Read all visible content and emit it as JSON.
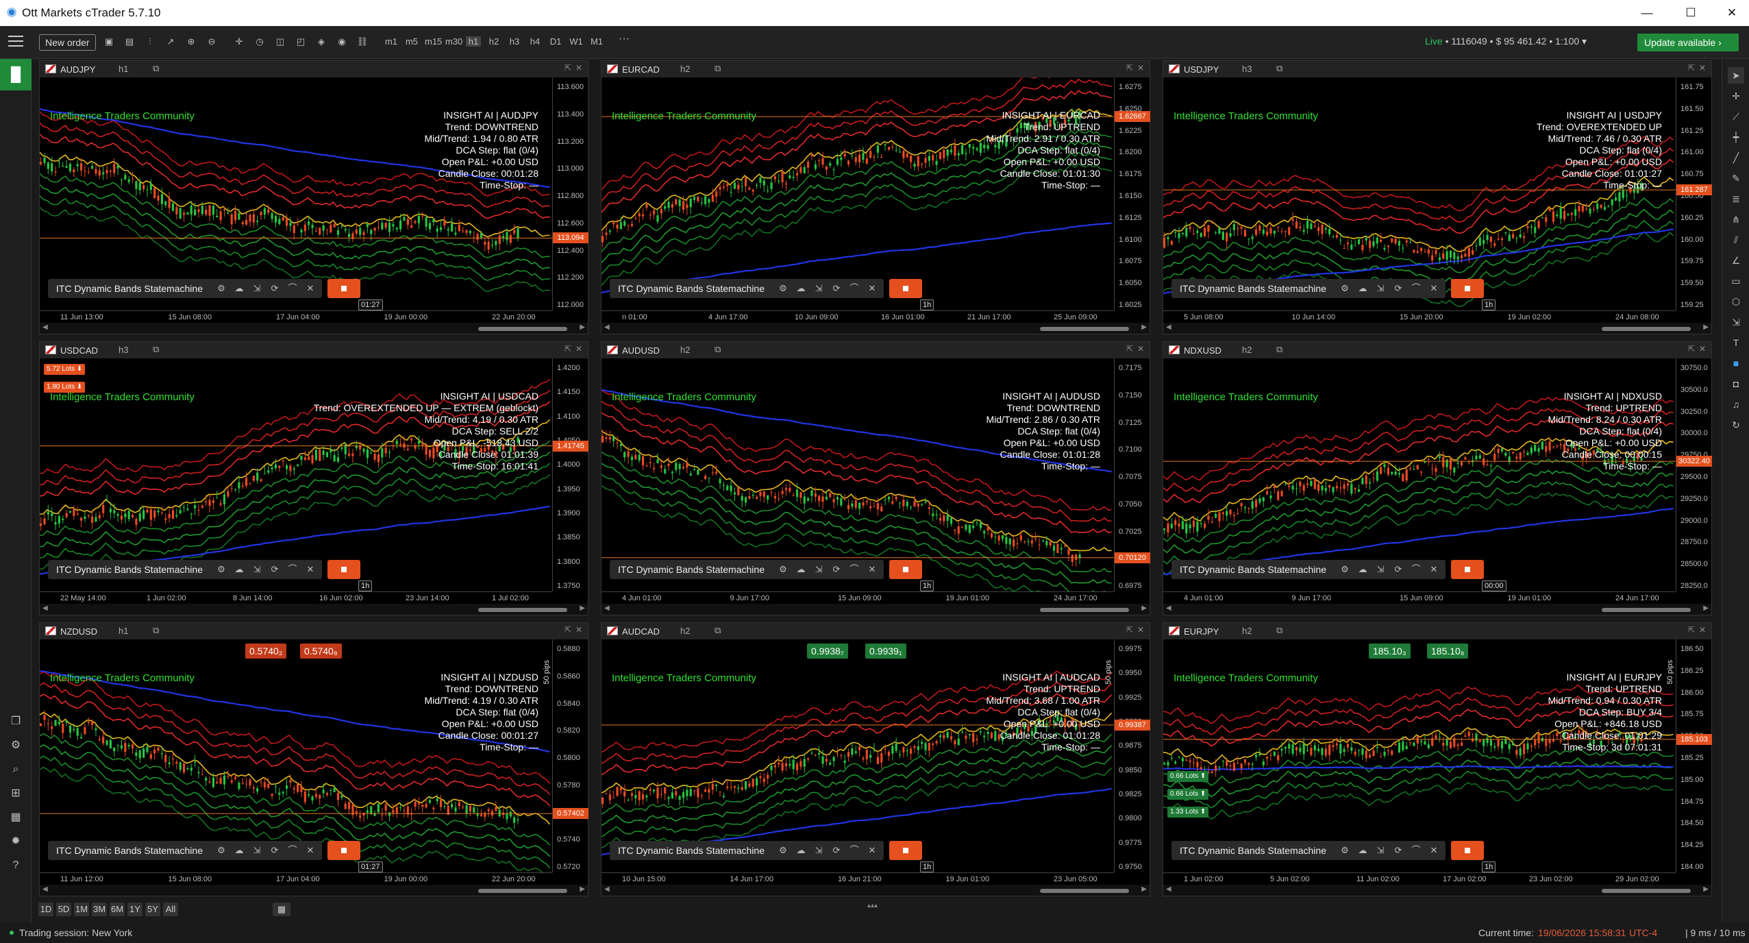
{
  "window": {
    "title": "Ott Markets cTrader 5.7.10",
    "minimize": "—",
    "maximize": "☐",
    "close": "✕"
  },
  "toolbar": {
    "new_order": "New order",
    "timeframes": [
      "m1",
      "m5",
      "m15",
      "m30",
      "h1",
      "h2",
      "h3",
      "h4",
      "D1",
      "W1",
      "M1"
    ],
    "more": "···",
    "account_live": "Live",
    "account_info": "• 1116049 • $ 95 461.42 • 1:100 ▾",
    "update": "Update available ›"
  },
  "indicator_label": "ITC Dynamic Bands Statemachine",
  "watermark": "Intelligence Traders Community",
  "colors": {
    "green": "#2ec25b",
    "orange": "#e4501e",
    "bg": "#000000",
    "accent_green": "#1f8b3a"
  },
  "panels": [
    {
      "symbol": "AUDJPY",
      "tf": "h1",
      "yticks": [
        "113.600",
        "113.400",
        "113.200",
        "113.000",
        "112.800",
        "112.600",
        "112.400",
        "112.200",
        "112.000"
      ],
      "price_tag": "113.094",
      "xticks": [
        "11 Jun 13:00",
        "15 Jun 08:00",
        "17 Jun 04:00",
        "19 Jun 00:00",
        "22 Jun 20:00"
      ],
      "tf_badge": "01:27",
      "trend": "down",
      "overlay": [
        "INSIGHT AI | AUDJPY",
        "Trend: DOWNTREND",
        "Mid/Trend: 1.94 / 0.80 ATR",
        "DCA Step: flat (0/4)",
        "Open P&L: +0.00 USD",
        "Candle Close: 00:01:28",
        "Time-Stop: —"
      ]
    },
    {
      "symbol": "EURCAD",
      "tf": "h2",
      "yticks": [
        "1.6275",
        "1.6250",
        "1.6225",
        "1.6200",
        "1.6175",
        "1.6150",
        "1.6125",
        "1.6100",
        "1.6075",
        "1.6050",
        "1.6025"
      ],
      "price_tag": "1.62667",
      "xticks": [
        "n 01:00",
        "4 Jun 17:00",
        "10 Jun 09:00",
        "16 Jun 01:00",
        "21 Jun 17:00",
        "25 Jun 09:00"
      ],
      "tf_badge": "1h",
      "trend": "up",
      "overlay": [
        "INSIGHT AI | EURCAD",
        "Trend: UPTREND",
        "Mid/Trend: 2.91 / 0.30 ATR",
        "DCA Step: flat (0/4)",
        "Open P&L: +0.00 USD",
        "Candle Close: 01:01:30",
        "Time-Stop: —"
      ]
    },
    {
      "symbol": "USDJPY",
      "tf": "h3",
      "yticks": [
        "161.75",
        "161.50",
        "161.25",
        "161.00",
        "160.75",
        "160.50",
        "160.25",
        "160.00",
        "159.75",
        "159.50",
        "159.25"
      ],
      "price_tag": "161.287",
      "xticks": [
        "5 Jun 08:00",
        "10 Jun 14:00",
        "15 Jun 20:00",
        "19 Jun 02:00",
        "24 Jun 08:00"
      ],
      "tf_badge": "1h",
      "trend": "up",
      "overlay": [
        "INSIGHT AI | USDJPY",
        "Trend: OVEREXTENDED UP",
        "Mid/Trend: 7.46 / 0.30 ATR",
        "DCA Step: flat (0/4)",
        "Open P&L: +0.00 USD",
        "Candle Close: 01:01:27",
        "Time-Stop: —"
      ]
    },
    {
      "symbol": "USDCAD",
      "tf": "h3",
      "yticks": [
        "1.4200",
        "1.4150",
        "1.4100",
        "1.4050",
        "1.4000",
        "1.3950",
        "1.3900",
        "1.3850",
        "1.3800",
        "1.3750"
      ],
      "price_tag": "1.41745",
      "xticks": [
        "22 May 14:00",
        "1 Jun 02:00",
        "8 Jun 14:00",
        "16 Jun 02:00",
        "23 Jun 14:00",
        "1 Jul 02:00"
      ],
      "tf_badge": "1h",
      "trend": "up",
      "lots": [
        "5.72 Lots ⬇",
        "1.90 Lots ⬇"
      ],
      "overlay": [
        "INSIGHT AI | USDCAD",
        "Trend: OVEREXTENDED UP — EXTREM (geblockt)",
        "Mid/Trend: 4.19 / 0.30 ATR",
        "DCA Step: SELL 2/2",
        "Open P&L: -518.43 USD",
        "Candle Close: 01:01:39",
        "Time-Stop: 16:01:41"
      ]
    },
    {
      "symbol": "AUDUSD",
      "tf": "h2",
      "yticks": [
        "0.7175",
        "0.7150",
        "0.7125",
        "0.7100",
        "0.7075",
        "0.7050",
        "0.7025",
        "0.7000",
        "0.6975"
      ],
      "price_tag": "0.70120",
      "xticks": [
        "4 Jun 01:00",
        "9 Jun 17:00",
        "15 Jun 09:00",
        "19 Jun 01:00",
        "24 Jun 17:00"
      ],
      "tf_badge": "1h",
      "trend": "down",
      "overlay": [
        "INSIGHT AI | AUDUSD",
        "Trend: DOWNTREND",
        "Mid/Trend: 2.86 / 0.30 ATR",
        "DCA Step: flat (0/4)",
        "Open P&L: +0.00 USD",
        "Candle Close: 01:01:28",
        "Time-Stop: —"
      ]
    },
    {
      "symbol": "NDXUSD",
      "tf": "h2",
      "yticks": [
        "30750.0",
        "30500.0",
        "30250.0",
        "30000.0",
        "29750.0",
        "29500.0",
        "29250.0",
        "29000.0",
        "28750.0",
        "28500.0",
        "28250.0"
      ],
      "price_tag": "30322.40",
      "xticks": [
        "4 Jun 01:00",
        "9 Jun 17:00",
        "15 Jun 09:00",
        "19 Jun 01:00",
        "24 Jun 17:00"
      ],
      "tf_badge": "00:00",
      "trend": "up",
      "overlay": [
        "INSIGHT AI | NDXUSD",
        "Trend: UPTREND",
        "Mid/Trend: 8.24 / 0.30 ATR",
        "DCA Step: flat (0/4)",
        "Open P&L: +0.00 USD",
        "Candle Close: 00:00:15",
        "Time-Stop: —"
      ]
    },
    {
      "symbol": "NZDUSD",
      "tf": "h1",
      "yticks": [
        "0.5880",
        "0.5860",
        "0.5840",
        "0.5820",
        "0.5800",
        "0.5780",
        "0.5760",
        "0.5740",
        "0.5720"
      ],
      "price_tag": "0.57402",
      "xticks": [
        "11 Jun 12:00",
        "15 Jun 08:00",
        "17 Jun 04:00",
        "19 Jun 00:00",
        "22 Jun 20:00"
      ],
      "tf_badge": "01:27",
      "trend": "down",
      "quotes": [
        "0.5740₂",
        "0.5740₈"
      ],
      "pips": "50 pips",
      "overlay": [
        "INSIGHT AI | NZDUSD",
        "Trend: DOWNTREND",
        "Mid/Trend: 4.19 / 0.30 ATR",
        "DCA Step: flat (0/4)",
        "Open P&L: +0.00 USD",
        "Candle Close: 00:01:27",
        "Time-Stop: —"
      ]
    },
    {
      "symbol": "AUDCAD",
      "tf": "h2",
      "yticks": [
        "0.9975",
        "0.9950",
        "0.9925",
        "0.9900",
        "0.9875",
        "0.9850",
        "0.9825",
        "0.9800",
        "0.9775",
        "0.9750"
      ],
      "price_tag": "0.99387",
      "xticks": [
        "10 Jun 15:00",
        "14 Jun 17:00",
        "16 Jun 21:00",
        "19 Jun 01:00",
        "23 Jun 05:00"
      ],
      "tf_badge": "1h",
      "trend": "up",
      "quotes": [
        "0.9938₇",
        "0.9939₁"
      ],
      "pips": "50 pips",
      "overlay": [
        "INSIGHT AI | AUDCAD",
        "Trend: UPTREND",
        "Mid/Trend: 3.68 / 1.00 ATR",
        "DCA Step: flat (0/4)",
        "Open P&L: +0.00 USD",
        "Candle Close: 01:01:28",
        "Time-Stop: —"
      ]
    },
    {
      "symbol": "EURJPY",
      "tf": "h2",
      "yticks": [
        "186.50",
        "186.25",
        "186.00",
        "185.75",
        "185.50",
        "185.25",
        "185.00",
        "184.75",
        "184.50",
        "184.25",
        "184.00"
      ],
      "price_tag": "185.103",
      "xticks": [
        "1 Jun 02:00",
        "5 Jun 02:00",
        "11 Jun 02:00",
        "17 Jun 02:00",
        "23 Jun 02:00",
        "29 Jun 02:00"
      ],
      "tf_badge": "1h",
      "trend": "flat",
      "quotes": [
        "185.10₃",
        "185.10₆"
      ],
      "pips": "50 pips",
      "lots": [
        "0.66 Lots ⬆",
        "0.66 Lots ⬆",
        "1.33 Lots ⬆"
      ],
      "overlay": [
        "INSIGHT AI | EURJPY",
        "Trend: UPTREND",
        "Mid/Trend: 0.94 / 0.30 ATR",
        "DCA Step: BUY 3/4",
        "Open P&L: +846.18 USD",
        "Candle Close: 01:01:29",
        "Time-Stop: 3d 07:01:31"
      ]
    }
  ],
  "periods": [
    "1D",
    "5D",
    "1M",
    "3M",
    "6M",
    "1Y",
    "5Y",
    "All"
  ],
  "status": {
    "session": "Trading session: New York",
    "current_time_label": "Current time:",
    "current_time": "19/06/2026 15:58:31",
    "tz": "UTC-4",
    "latency": "| 9 ms / 10 ms"
  }
}
